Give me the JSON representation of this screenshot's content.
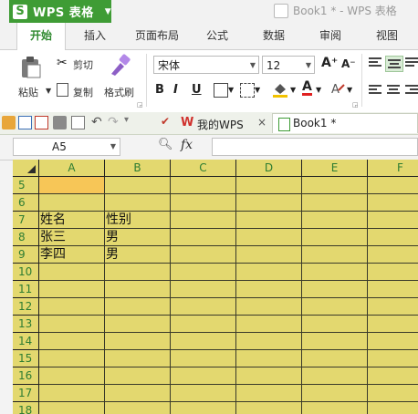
{
  "app": {
    "name": "WPS 表格",
    "logo_letter": "S",
    "doc_title": "Book1 * - WPS 表格"
  },
  "ribbon_tabs": [
    "开始",
    "插入",
    "页面布局",
    "公式",
    "数据",
    "审阅",
    "视图"
  ],
  "clipboard": {
    "paste": "粘贴",
    "cut": "剪切",
    "copy": "复制",
    "format_painter": "格式刷"
  },
  "font": {
    "name": "宋体",
    "size": "12",
    "grow": "A⁺",
    "shrink": "A⁻",
    "bold": "B",
    "italic": "I",
    "underline": "U",
    "color_letter": "A"
  },
  "doc_tabs": {
    "wps": "我的WPS",
    "book": "Book1 *"
  },
  "formula_bar": {
    "cell_ref": "A5",
    "fx": "fx",
    "value": ""
  },
  "sheet": {
    "columns": [
      "A",
      "B",
      "C",
      "D",
      "E",
      "F"
    ],
    "rows": [
      "5",
      "6",
      "7",
      "8",
      "9",
      "10",
      "11",
      "12",
      "13",
      "14",
      "15",
      "16",
      "17",
      "18"
    ],
    "selected_cell": "A5",
    "cells": [
      [
        "",
        "",
        "",
        "",
        "",
        ""
      ],
      [
        "",
        "",
        "",
        "",
        "",
        ""
      ],
      [
        "姓名",
        "性别",
        "",
        "",
        "",
        ""
      ],
      [
        "张三",
        "男",
        "",
        "",
        "",
        ""
      ],
      [
        "李四",
        "男",
        "",
        "",
        "",
        ""
      ]
    ]
  },
  "colors": {
    "accent_green": "#3f9c35",
    "cell_fill": "#e3d86f",
    "selection": "#f7c657",
    "header_text": "#2e7d32"
  }
}
